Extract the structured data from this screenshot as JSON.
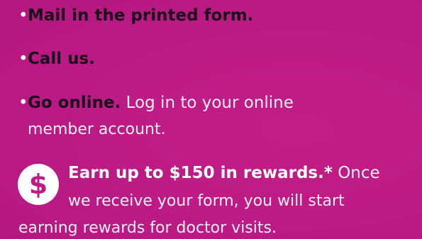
{
  "options": [
    {
      "bullet": "•",
      "bold": "Mail in the printed form."
    },
    {
      "bullet": "•",
      "bold": "Call us."
    },
    {
      "bullet": "•",
      "bold": "Go online.",
      "rest_line1": "Log in to your online",
      "rest_line2": "member account."
    }
  ],
  "reward": {
    "icon_name": "dollar-icon",
    "icon_glyph": "$",
    "bold": "Earn up to $150 in rewards.*",
    "line1_rest": "Once",
    "line2": "we receive your form, you will start",
    "line3": "earning rewards for doctor visits."
  }
}
